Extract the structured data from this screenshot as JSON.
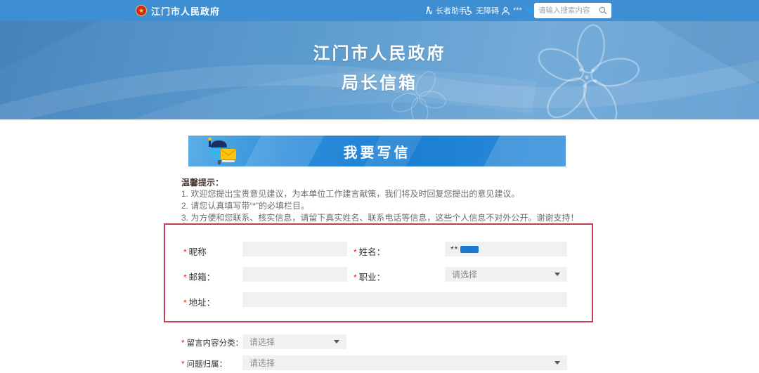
{
  "topbar": {
    "site_name": "江门市人民政府",
    "elder_link": "长者助手",
    "accessibility_link": "无障碍",
    "user_masked": "***",
    "search_placeholder": "请输入搜索内容"
  },
  "banner": {
    "title_line1": "江门市人民政府",
    "title_line2": "局长信箱"
  },
  "section_header": {
    "title": "我要写信"
  },
  "tips": {
    "heading": "温馨提示：",
    "items": [
      "1. 欢迎您提出宝贵意见建议，为本单位工作建言献策，我们将及时回复您提出的意见建议。",
      "2. 请您认真填写带“*”的必填栏目。",
      "3. 为方便和您联系、核实信息，请留下真实姓名、联系电话等信息，这些个人信息不对外公开。谢谢支持！"
    ]
  },
  "form": {
    "required_mark": "*",
    "nickname_label": "昵称",
    "nickname_value": "",
    "name_label": "姓名：",
    "name_value": "**",
    "email_label": "邮箱：",
    "email_value": "",
    "occupation_label": "职业：",
    "occupation_value": "请选择",
    "address_label": "地址：",
    "address_value": "",
    "category_label": "留言内容分类：",
    "category_value": "请选择",
    "attribution_label": "问题归属：",
    "attribution_value": "请选择"
  },
  "colors": {
    "topbar_blue": "#3d8ed3",
    "banner_blue": "#5b9ccf",
    "header_blue": "#1d7fd2",
    "annotation_red": "#c73b52",
    "redaction_blue": "#1e78d0",
    "input_bg": "#f0f1f3",
    "envelope_yellow": "#ffc412",
    "mailbox_blue": "#3fb0ee"
  }
}
